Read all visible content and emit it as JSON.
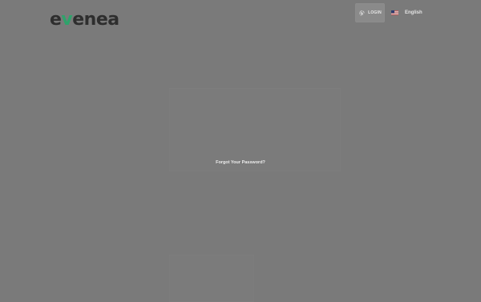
{
  "header": {
    "logo_text": "evenea",
    "login_label": "LOGIN",
    "language_label": "English"
  },
  "form": {
    "forgot_password_link": "Forgot Your Password?"
  },
  "colors": {
    "overlay_gray": "#7a7a7a",
    "logo_dark": "#2e2e2e",
    "logo_accent": "#2ea36b"
  },
  "icons": {
    "login_icon": "fingerprint-icon",
    "language_icon": "us-flag-icon"
  }
}
